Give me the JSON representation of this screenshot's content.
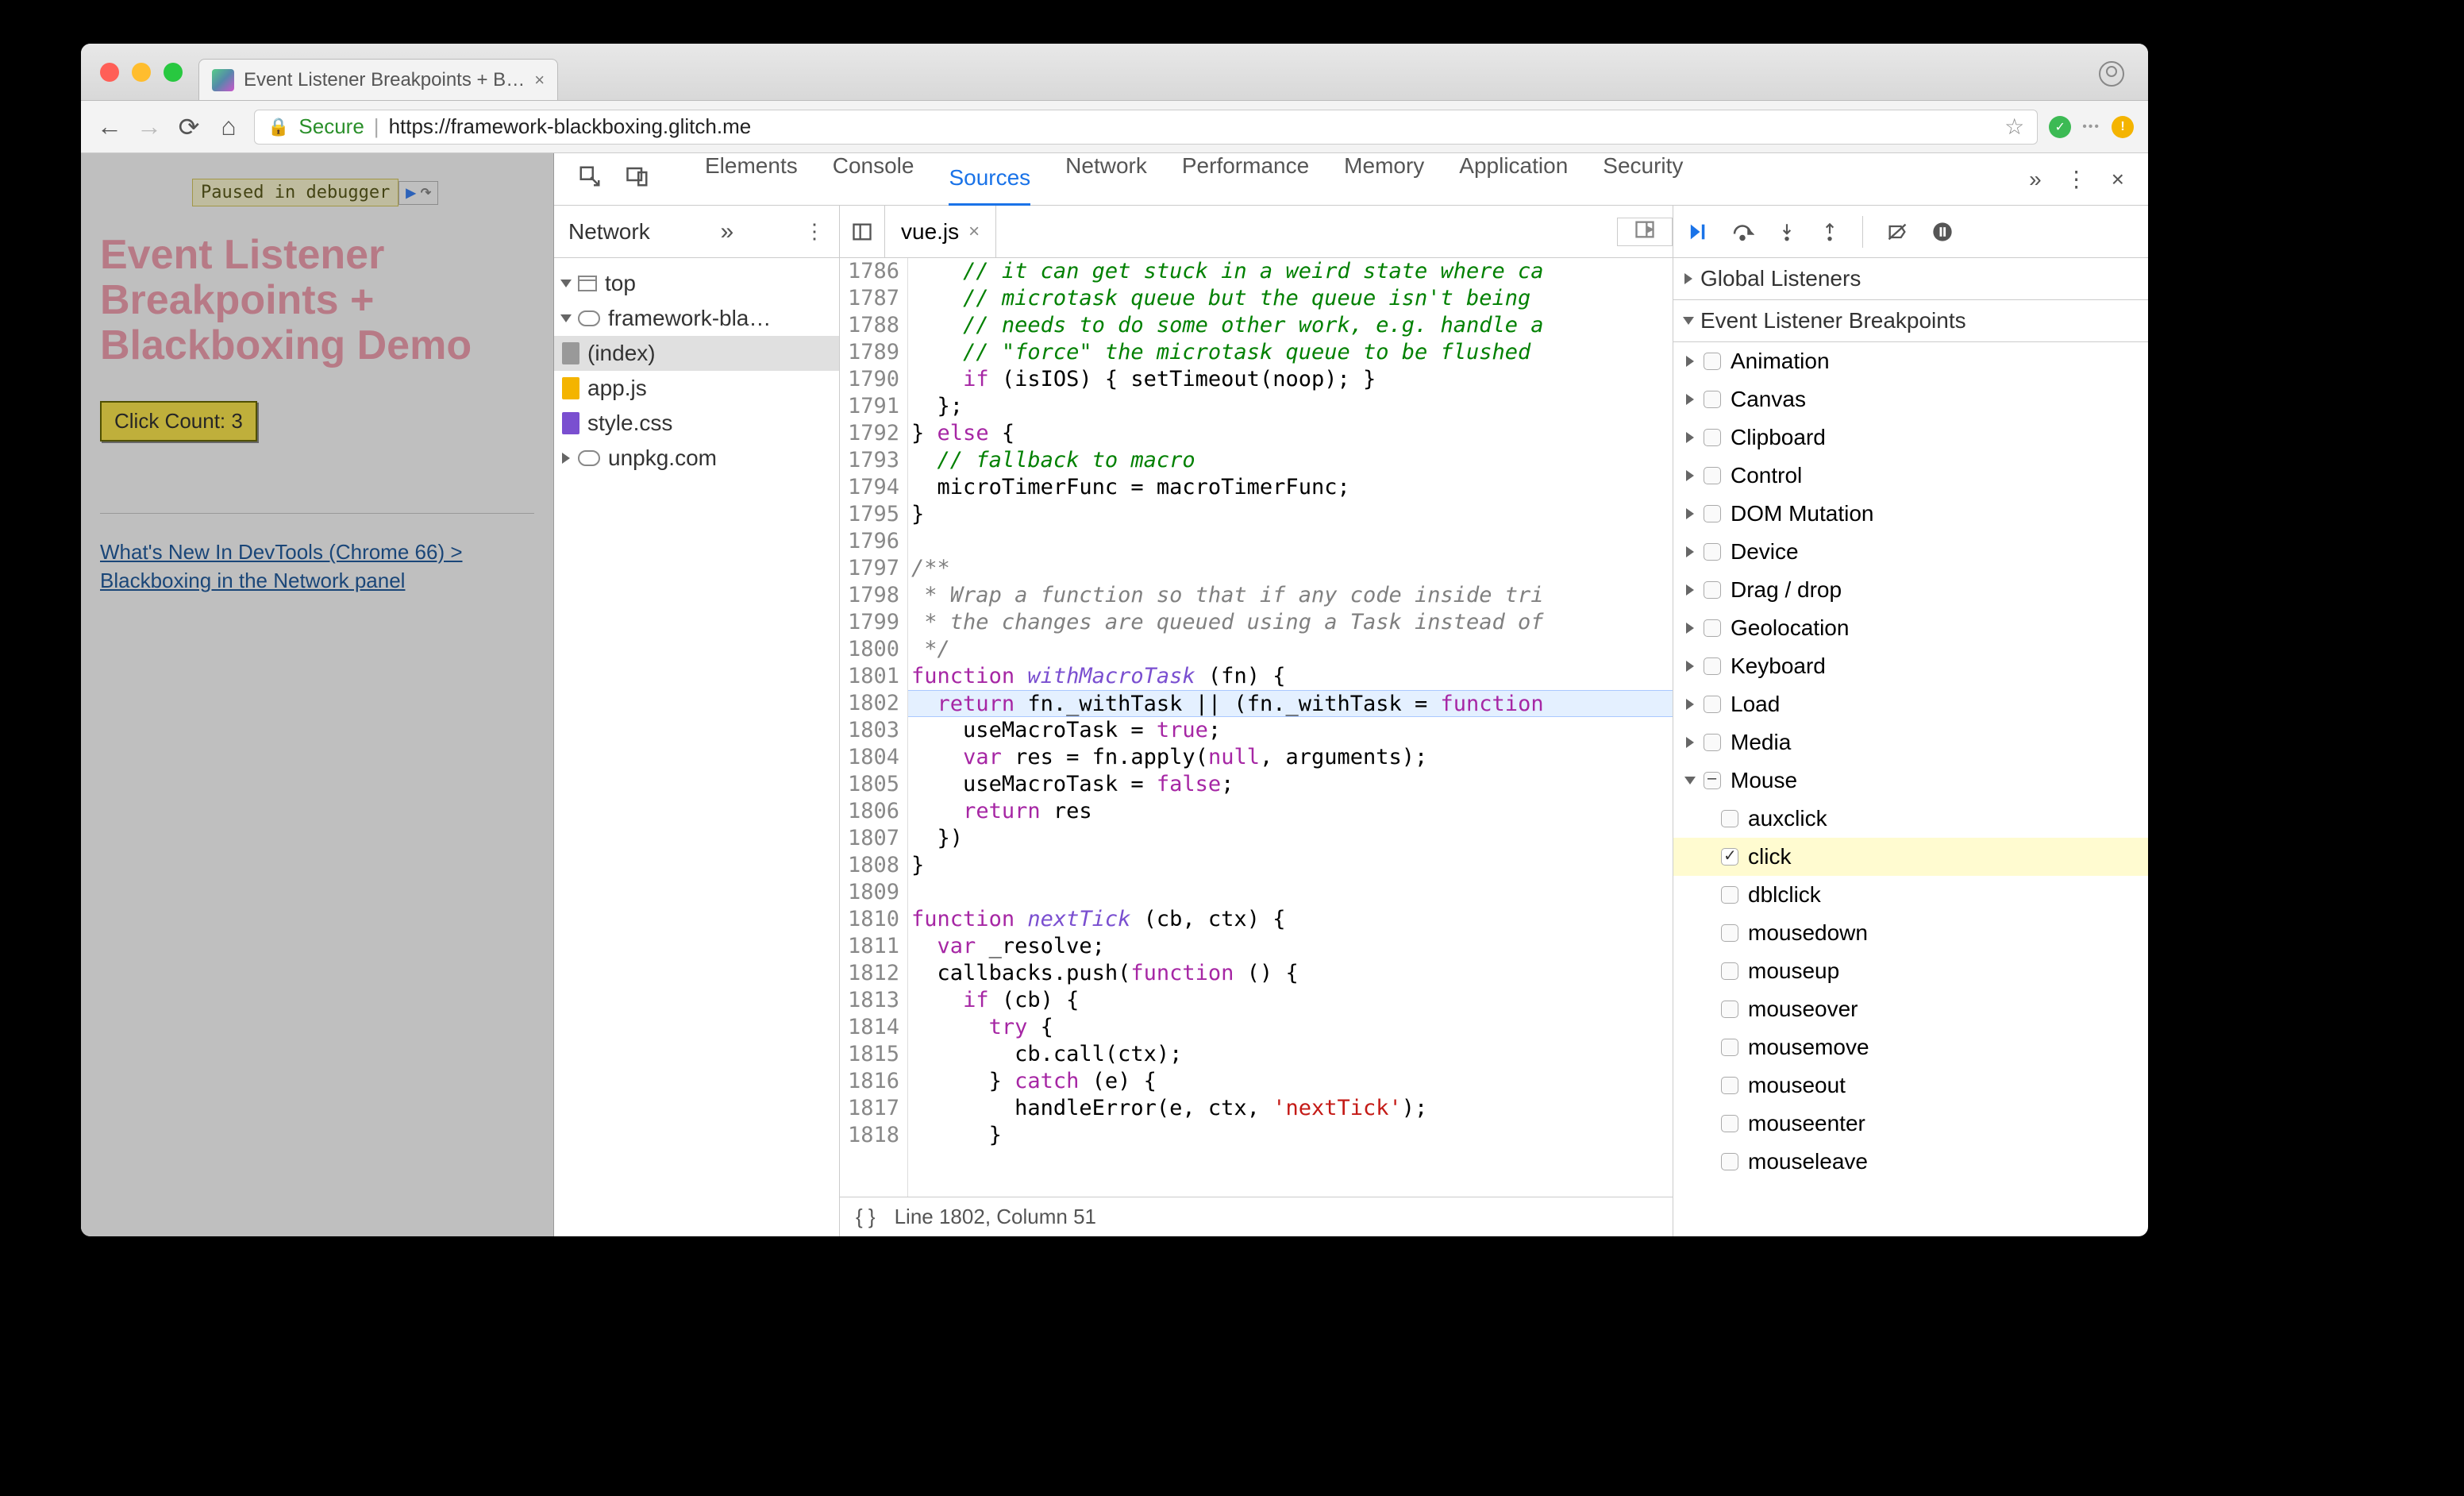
{
  "tab_title": "Event Listener Breakpoints + B…",
  "address": {
    "secure": "Secure",
    "url_proto": "https",
    "url_rest": "://framework-blackboxing.glitch.me"
  },
  "page": {
    "pause_label": "Paused in debugger",
    "heading": "Event Listener Breakpoints + Blackboxing Demo",
    "click_prefix": "Click Count: ",
    "click_count": 3,
    "link": "What's New In DevTools (Chrome 66) > Blackboxing in the Network panel"
  },
  "devtools": {
    "tabs": [
      "Elements",
      "Console",
      "Sources",
      "Network",
      "Performance",
      "Memory",
      "Application",
      "Security"
    ],
    "active_tab": "Sources",
    "nav_tab": "Network",
    "tree": {
      "top": "top",
      "domain": "framework-bla…",
      "files": [
        "(index)",
        "app.js",
        "style.css"
      ],
      "ext_domain": "unpkg.com"
    },
    "editor_file": "vue.js",
    "gutter_start": 1786,
    "gutter_end": 1818,
    "highlight_line": 1802,
    "code_lines": [
      {
        "i": 0,
        "html": "    <span class='com'>// it can get stuck in a weird state where ca</span>"
      },
      {
        "i": 1,
        "html": "    <span class='com'>// microtask queue but the queue isn't being</span>"
      },
      {
        "i": 2,
        "html": "    <span class='com'>// needs to do some other work, e.g. handle a</span>"
      },
      {
        "i": 3,
        "html": "    <span class='com'>// \"force\" the microtask queue to be flushed</span>"
      },
      {
        "i": 4,
        "html": "    <span class='kw'>if</span> (isIOS) { setTimeout(noop); }"
      },
      {
        "i": 5,
        "html": "  };"
      },
      {
        "i": 6,
        "html": "} <span class='kw'>else</span> {"
      },
      {
        "i": 7,
        "html": "  <span class='com'>// fallback to macro</span>"
      },
      {
        "i": 8,
        "html": "  microTimerFunc = macroTimerFunc;"
      },
      {
        "i": 9,
        "html": "}"
      },
      {
        "i": 10,
        "html": ""
      },
      {
        "i": 11,
        "html": "<span class='com2'>/**</span>"
      },
      {
        "i": 12,
        "html": "<span class='com2'> * Wrap a function so that if any code inside tri</span>"
      },
      {
        "i": 13,
        "html": "<span class='com2'> * the changes are queued using a Task instead of</span>"
      },
      {
        "i": 14,
        "html": "<span class='com2'> */</span>"
      },
      {
        "i": 15,
        "html": "<span class='kw'>function</span> <span class='fn'>withMacroTask</span> (fn) {"
      },
      {
        "i": 16,
        "html": "  <span class='kw'>return</span> fn._withTask || (fn._withTask = <span class='kw'>function</span>"
      },
      {
        "i": 17,
        "html": "    useMacroTask = <span class='kw'>true</span>;"
      },
      {
        "i": 18,
        "html": "    <span class='kw'>var</span> res = fn.apply(<span class='kw'>null</span>, arguments);"
      },
      {
        "i": 19,
        "html": "    useMacroTask = <span class='kw'>false</span>;"
      },
      {
        "i": 20,
        "html": "    <span class='kw'>return</span> res"
      },
      {
        "i": 21,
        "html": "  })"
      },
      {
        "i": 22,
        "html": "}"
      },
      {
        "i": 23,
        "html": ""
      },
      {
        "i": 24,
        "html": "<span class='kw'>function</span> <span class='fn'>nextTick</span> (cb, ctx) {"
      },
      {
        "i": 25,
        "html": "  <span class='kw'>var</span> _resolve;"
      },
      {
        "i": 26,
        "html": "  callbacks.push(<span class='kw'>function</span> () {"
      },
      {
        "i": 27,
        "html": "    <span class='kw'>if</span> (cb) {"
      },
      {
        "i": 28,
        "html": "      <span class='kw'>try</span> {"
      },
      {
        "i": 29,
        "html": "        cb.call(ctx);"
      },
      {
        "i": 30,
        "html": "      } <span class='kw'>catch</span> (e) {"
      },
      {
        "i": 31,
        "html": "        handleError(e, ctx, <span class='str'>'nextTick'</span>);"
      },
      {
        "i": 32,
        "html": "      }"
      }
    ],
    "status": "Line 1802, Column 51",
    "format_icon": "{ }",
    "right": {
      "global": "Global Listeners",
      "elb": "Event Listener Breakpoints",
      "cats": [
        "Animation",
        "Canvas",
        "Clipboard",
        "Control",
        "DOM Mutation",
        "Device",
        "Drag / drop",
        "Geolocation",
        "Keyboard",
        "Load",
        "Media"
      ],
      "mouse_cat": "Mouse",
      "mouse_subs": [
        "auxclick",
        "click",
        "dblclick",
        "mousedown",
        "mouseup",
        "mouseover",
        "mousemove",
        "mouseout",
        "mouseenter",
        "mouseleave"
      ],
      "mouse_checked": "click"
    }
  }
}
